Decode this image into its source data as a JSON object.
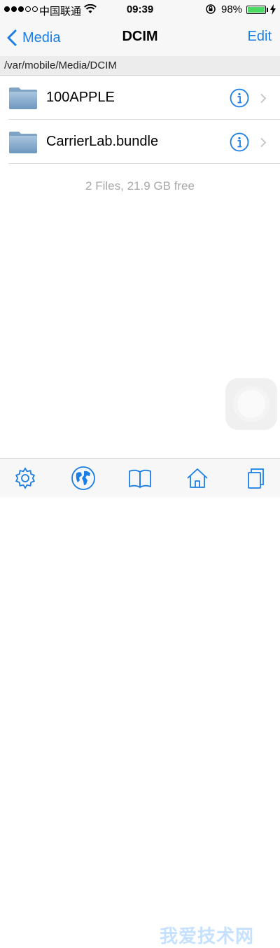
{
  "status_bar": {
    "carrier": "中国联通",
    "time": "09:39",
    "battery_percent": "98%",
    "battery_level": 0.98
  },
  "nav": {
    "back_label": "Media",
    "title": "DCIM",
    "edit_label": "Edit"
  },
  "path": "/var/mobile/Media/DCIM",
  "files": [
    {
      "name": "100APPLE",
      "icon": "folder-icon"
    },
    {
      "name": "CarrierLab.bundle",
      "icon": "folder-icon"
    }
  ],
  "summary": "2 Files, 21.9 GB free",
  "tab_bar": {
    "icons": [
      "gear-icon",
      "globe-icon",
      "book-icon",
      "home-icon",
      "copy-icon"
    ]
  },
  "watermark": "我爱技术网",
  "colors": {
    "accent": "#1a7ee6",
    "battery": "#4cd964"
  }
}
